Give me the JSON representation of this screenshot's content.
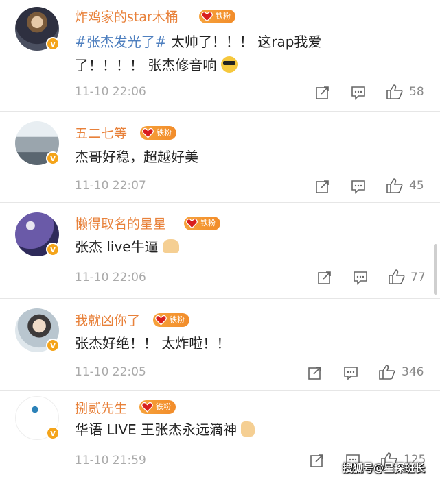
{
  "comments": [
    {
      "username": "炸鸡家的star木桶",
      "badge": "铁粉",
      "text_tag": "#张杰发光了#",
      "text": " 太帅了！！！ 这rap我爱了！！！！ 张杰修音响",
      "emoji": "sunglasses-emoji",
      "time": "11-10 22:06",
      "likes": "58"
    },
    {
      "username": "五二七等",
      "badge": "铁粉",
      "text": "杰哥好稳，超越好美",
      "time": "11-10 22:07",
      "likes": "45"
    },
    {
      "username": "懒得取名的星星",
      "badge": "铁粉",
      "text": "张杰 live牛逼",
      "emoji": "clapping-hands-emoji",
      "time": "11-10 22:06",
      "likes": "77"
    },
    {
      "username": "我就凶你了",
      "badge": "铁粉",
      "text": "张杰好绝！！ 太炸啦！！",
      "time": "11-10 22:05",
      "likes": "346"
    },
    {
      "username": "捌贰先生",
      "badge": "铁粉",
      "text": "华语 LIVE 王张杰永远滴神",
      "emoji": "thumbs-up-emoji",
      "time": "11-10 21:59",
      "likes": "125"
    }
  ],
  "watermark": "搜狐号@星探班长",
  "colors": {
    "username": "#e8813a",
    "badge": "#f28c2a",
    "tag": "#4e7fbf",
    "time": "#aaaaaa"
  }
}
